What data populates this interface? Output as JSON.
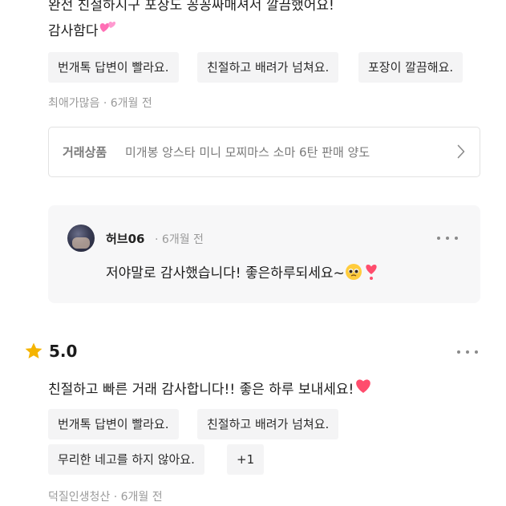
{
  "review1": {
    "text_line1": "완전 친절하시구 포장도 꽁꽁싸매셔서 깔끔했어요!",
    "text_line2": "감사함다",
    "emoji_icon": "two-hearts-icon",
    "tags": [
      "번개톡 답변이 빨라요.",
      "친절하고 배려가 넘쳐요.",
      "포장이 깔끔해요."
    ],
    "author": "최애가많음",
    "time": "6개월 전",
    "separator": "·"
  },
  "product": {
    "label": "거래상품",
    "name": "미개봉 앙스타 미니 모찌마스 소마 6탄 판매 양도",
    "chevron_icon": "chevron-right-icon"
  },
  "reply": {
    "author": "허브06",
    "time": "6개월 전",
    "separator": "·",
    "text": "저야말로 감사했습니다! 좋은하루되세요~",
    "emoji_icons": [
      "pleading-face-icon",
      "heart-exclamation-icon"
    ],
    "more_icon": "more-horizontal-icon"
  },
  "review2": {
    "star_icon": "star-icon",
    "rating": "5.0",
    "text": "친절하고 빠른 거래 감사합니다!! 좋은 하루 보내세요!",
    "emoji_icon": "heart-icon",
    "tags": [
      "번개톡 답변이 빨라요.",
      "친절하고 배려가 넘쳐요.",
      "무리한 네고를 하지 않아요."
    ],
    "more_tags": "+1",
    "author": "덕질인생청산",
    "time": "6개월 전",
    "separator": "·",
    "more_icon": "more-horizontal-icon"
  },
  "colors": {
    "chip_bg": "#f4f4f5",
    "reply_bg": "#f7f7f8",
    "meta_text": "#9a9a9a",
    "star": "#f5b400",
    "heart": "#ff4d6d"
  }
}
